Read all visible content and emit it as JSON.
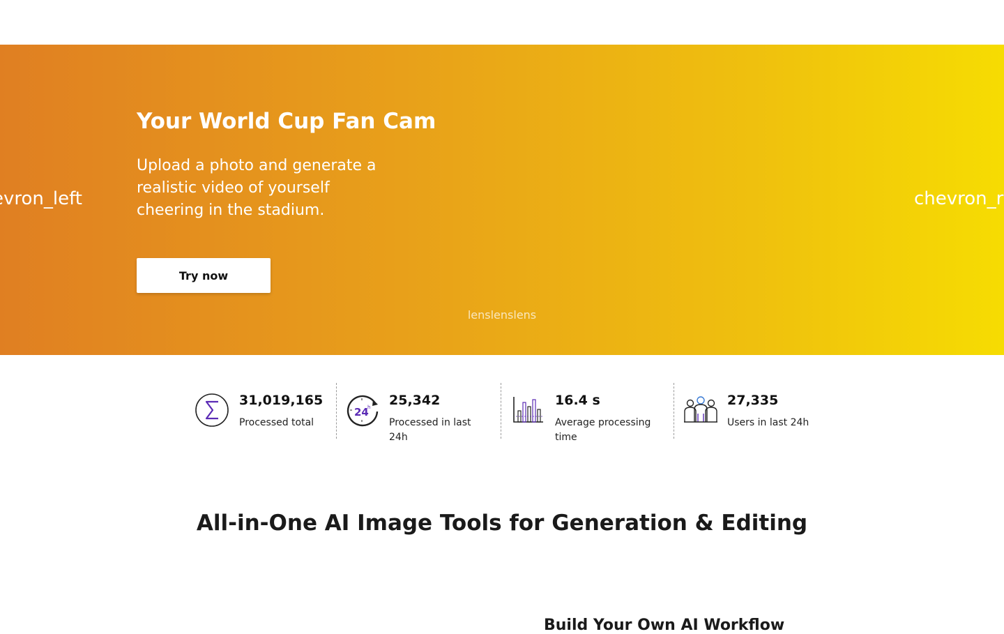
{
  "hero": {
    "title": "Your World Cup Fan Cam",
    "subtitle": "Upload a photo and generate a realistic video of yourself cheering in the stadium.",
    "cta_label": "Try now",
    "prev_label": "chevron_left",
    "next_label": "chevron_right",
    "indicators": "lenslenslens",
    "gradient_colors": [
      "#e07f22",
      "#efc00e",
      "#f6dc02"
    ]
  },
  "stats": [
    {
      "value": "31,019,165",
      "label": "Processed total",
      "icon": "sigma-icon"
    },
    {
      "value": "25,342",
      "label": "Processed in last 24h",
      "icon": "clock-24h-icon"
    },
    {
      "value": "16.4 s",
      "label": "Average processing time",
      "icon": "bar-chart-icon"
    },
    {
      "value": "27,335",
      "label": "Users in last 24h",
      "icon": "users-icon"
    }
  ],
  "sections": {
    "tools_title": "All-in-One AI Image Tools for Generation & Editing",
    "workflow_title": "Build Your Own AI Workflow"
  },
  "colors": {
    "accent": "#5b2bb5",
    "icon_stroke": "#222222"
  }
}
